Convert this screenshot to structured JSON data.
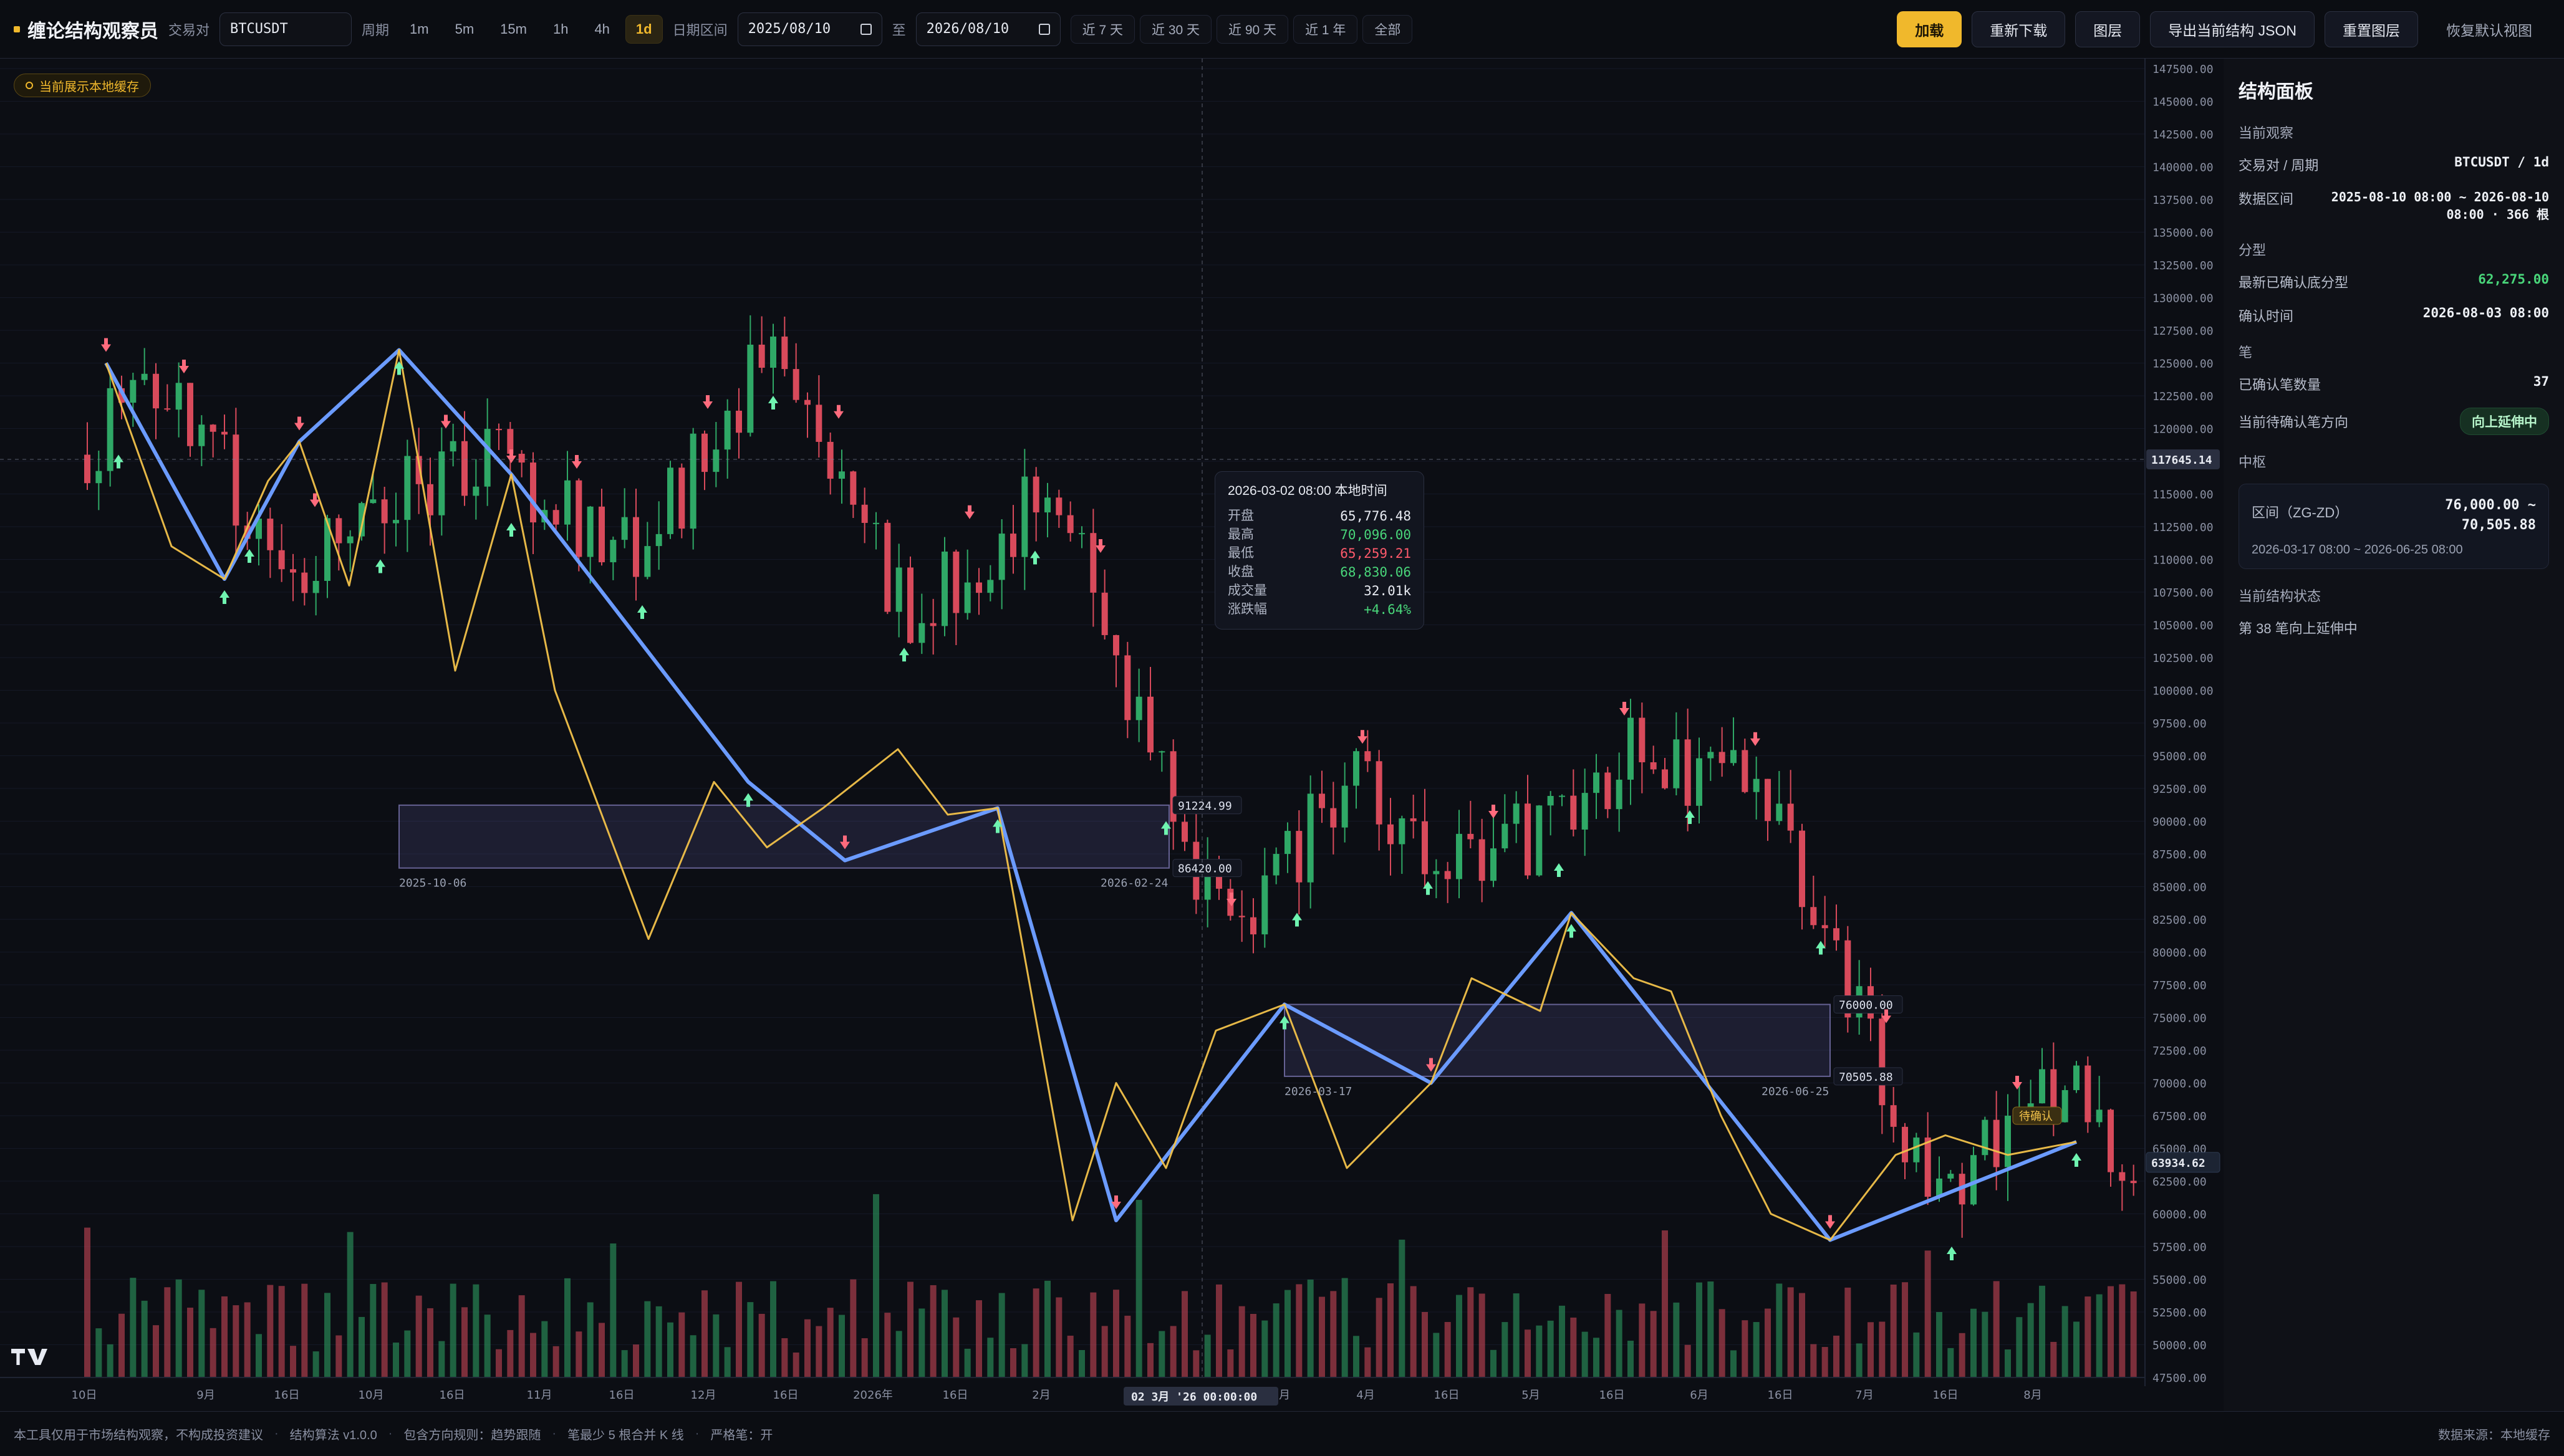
{
  "header": {
    "title": "缠论结构观察员",
    "pair_label": "交易对",
    "pair_value": "BTCUSDT",
    "period_label": "周期",
    "periods": [
      "1m",
      "5m",
      "15m",
      "1h",
      "4h",
      "1d"
    ],
    "active_period": "1d",
    "date_label": "日期区间",
    "date_from": "2025/08/10",
    "date_to_label": "至",
    "date_to": "2026/08/10",
    "ranges": [
      "近 7 天",
      "近 30 天",
      "近 90 天",
      "近 1 年",
      "全部"
    ],
    "buttons": {
      "load": "加载",
      "reload": "重新下载",
      "layers": "图层",
      "export": "导出当前结构 JSON",
      "reset_layers": "重置图层",
      "restore_view": "恢复默认视图"
    }
  },
  "chart_status": {
    "cache_pill": "当前展示本地缓存"
  },
  "tooltip": {
    "title": "2026-03-02 08:00 本地时间",
    "rows": [
      {
        "k": "开盘",
        "v": "65,776.48",
        "tone": "n"
      },
      {
        "k": "最高",
        "v": "70,096.00",
        "tone": "g"
      },
      {
        "k": "最低",
        "v": "65,259.21",
        "tone": "r"
      },
      {
        "k": "收盘",
        "v": "68,830.06",
        "tone": "g"
      },
      {
        "k": "成交量",
        "v": "32.01k",
        "tone": "n"
      },
      {
        "k": "涨跌幅",
        "v": "+4.64%",
        "tone": "g"
      }
    ]
  },
  "chart_data": {
    "type": "candlestick",
    "y_axis": {
      "min": 47500,
      "max": 147500,
      "step": 2500
    },
    "x_axis": {
      "ticks": [
        "10日",
        "9月",
        "16日",
        "10月",
        "16日",
        "11月",
        "16日",
        "12月",
        "16日",
        "2026年",
        "16日",
        "2月",
        "月",
        "4月",
        "16日",
        "5月",
        "16日",
        "6月",
        "16日",
        "7月",
        "16日",
        "8月"
      ],
      "crosshair_label": "02 3月 '26   00:00:00"
    },
    "price_labels": {
      "crosshair": "117645.14",
      "last": "63934.62"
    },
    "zhongshu": [
      {
        "top": "91224.99",
        "bottom": "86420.00",
        "start": "2025-10-06",
        "end": "2026-02-24",
        "top_value": 91224.99,
        "bottom_value": 86420.0
      },
      {
        "top": "76000.00",
        "bottom": "70505.88",
        "start": "2026-03-17",
        "end": "2026-06-25",
        "top_value": 76000.0,
        "bottom_value": 70505.88
      }
    ],
    "small_tag": "待确认",
    "colors": {
      "up": "#2fa866",
      "down": "#d84a5b",
      "stroke": "#6b9bff",
      "segment": "#f2c24a",
      "box_fill": "#6e67b8",
      "box_edge": "#9c95e0"
    }
  },
  "panel": {
    "title": "结构面板",
    "sec_current": "当前观察",
    "pair_period_k": "交易对 / 周期",
    "pair_period_v": "BTCUSDT / 1d",
    "range_k": "数据区间",
    "range_v": "2025-08-10 08:00 ~ 2026-08-10 08:00 · 366 根",
    "sec_fenxing": "分型",
    "latest_fx_k": "最新已确认底分型",
    "latest_fx_v": "62,275.00",
    "confirm_time_k": "确认时间",
    "confirm_time_v": "2026-08-03 08:00",
    "sec_bi": "笔",
    "bi_count_k": "已确认笔数量",
    "bi_count_v": "37",
    "pending_dir_k": "当前待确认笔方向",
    "pending_dir_v": "向上延伸中",
    "sec_zs": "中枢",
    "zs_k": "区间（ZG-ZD）",
    "zs_v": "76,000.00 ~ 70,505.88",
    "zs_time": "2026-03-17 08:00 ~ 2026-06-25 08:00",
    "sec_state": "当前结构状态",
    "state_v": "第 38 笔向上延伸中"
  },
  "footer": {
    "disclaimer": "本工具仅用于市场结构观察，不构成投资建议",
    "algo": "结构算法 v1.0.0",
    "rule": "包含方向规则：趋势跟随",
    "min_bars": "笔最少 5 根合并 K 线",
    "strict": "严格笔：开",
    "source": "数据来源：本地缓存"
  }
}
